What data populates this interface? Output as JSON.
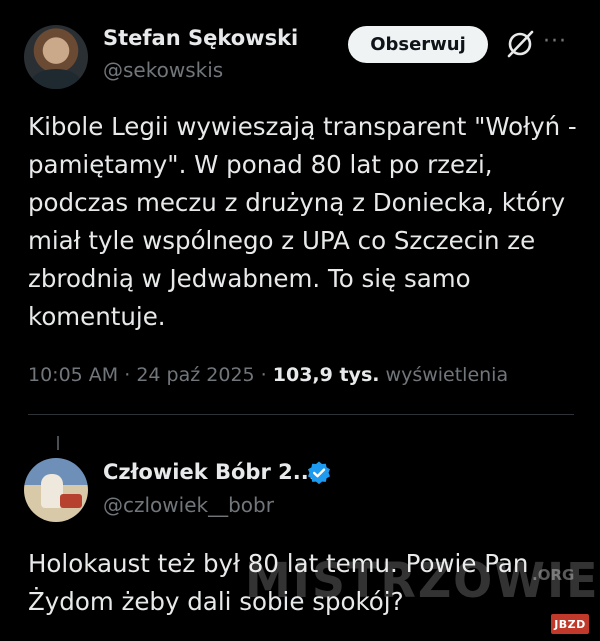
{
  "tweet": {
    "author_name": "Stefan Sękowski",
    "author_handle": "@sekowskis",
    "follow_label": "Obserwuj",
    "more_label": "···",
    "text": "Kibole Legii wywieszają transparent  \"Wołyń - pamiętamy\". W ponad 80 lat po rzezi, podczas meczu z drużyną z Doniecka, który miał tyle wspólnego z UPA co Szczecin ze zbrodnią w Jedwabnem. To się samo komentuje.",
    "time": "10:05 AM",
    "separator": "·",
    "date": "24 paź 2025",
    "views_count": "103,9 tys.",
    "views_label": "wyświetlenia"
  },
  "reply": {
    "author_name": "Człowiek Bóbr 2...",
    "author_handle": "@czlowiek__bobr",
    "text": "Holokaust też był 80 lat temu. Powie Pan Żydom żeby dali sobie spokój?"
  },
  "watermark": {
    "text": "MISTRZOWIE",
    "domain": ".ORG",
    "badge": "JBZD"
  },
  "colors": {
    "background": "#000000",
    "text": "#e7e9ea",
    "secondary_text": "#71767b",
    "verified_blue": "#1d9bf0",
    "button_bg": "#eff3f4"
  }
}
